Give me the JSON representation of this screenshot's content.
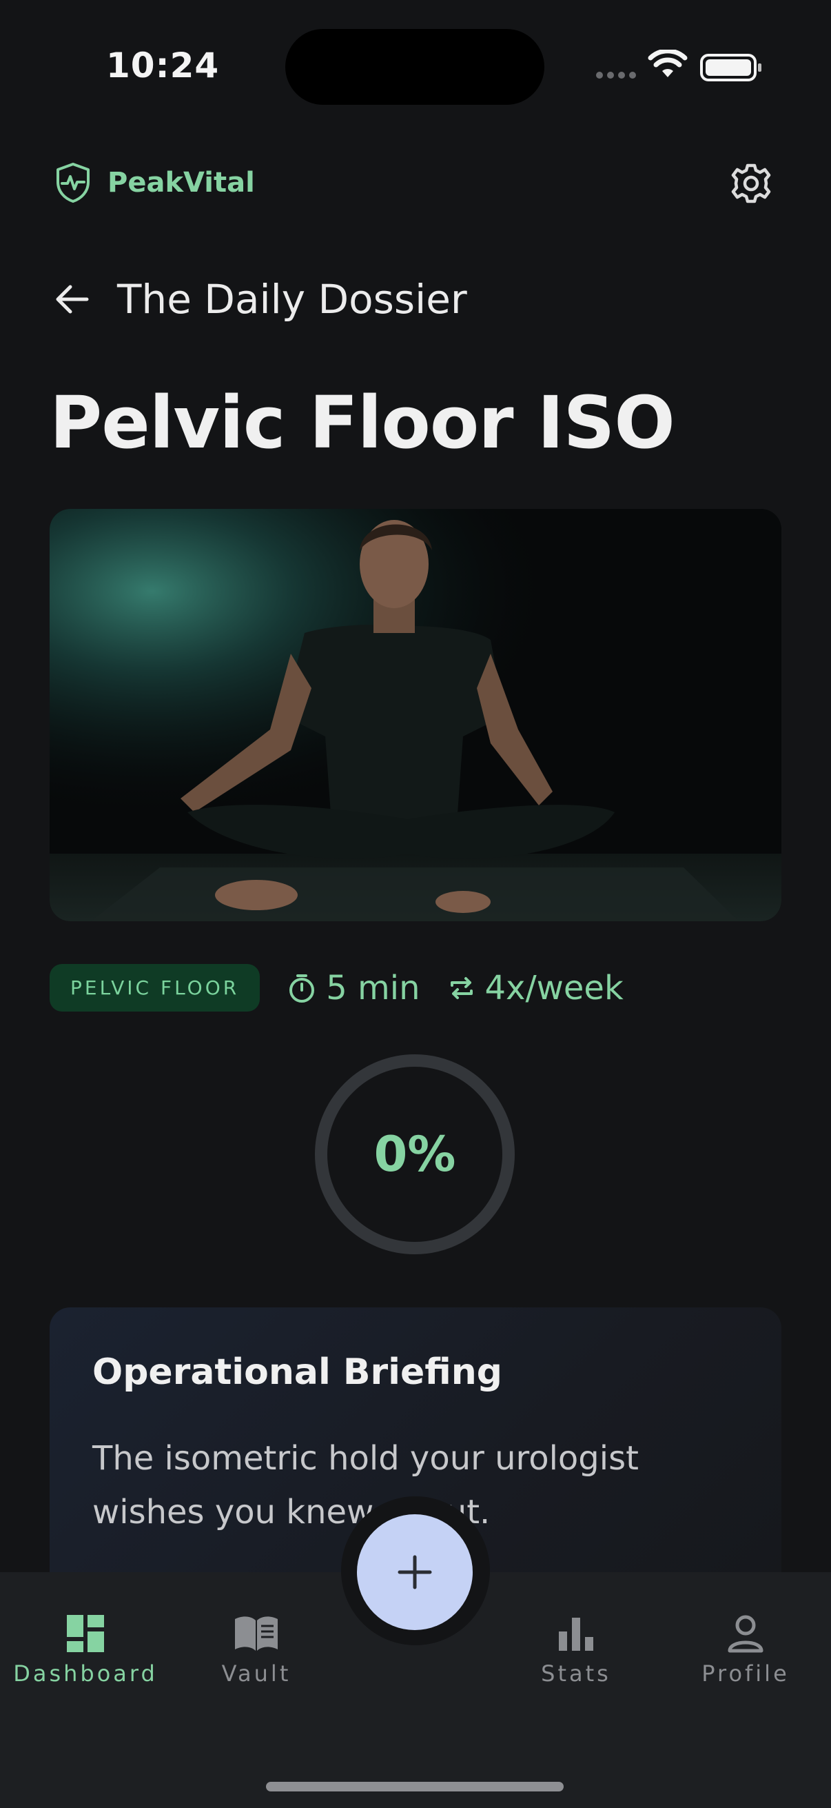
{
  "status": {
    "time": "10:24"
  },
  "brand": {
    "name": "PeakVital",
    "accent": "#86d3a2"
  },
  "header": {
    "back_title": "The Daily Dossier"
  },
  "exercise": {
    "title": "Pelvic Floor ISO",
    "badge": "PELVIC FLOOR",
    "duration": "5 min",
    "frequency": "4x/week",
    "progress_label": "0%",
    "progress": 0
  },
  "briefing": {
    "title": "Operational Briefing",
    "body": "The isometric hold your urologist wishes you knew about."
  },
  "nav": {
    "items": [
      {
        "label": "Dashboard",
        "icon": "dashboard-icon",
        "active": true
      },
      {
        "label": "Vault",
        "icon": "book-icon",
        "active": false
      },
      {
        "label": "Stats",
        "icon": "bar-chart-icon",
        "active": false
      },
      {
        "label": "Profile",
        "icon": "person-icon",
        "active": false
      }
    ],
    "fab_icon": "plus-icon"
  }
}
